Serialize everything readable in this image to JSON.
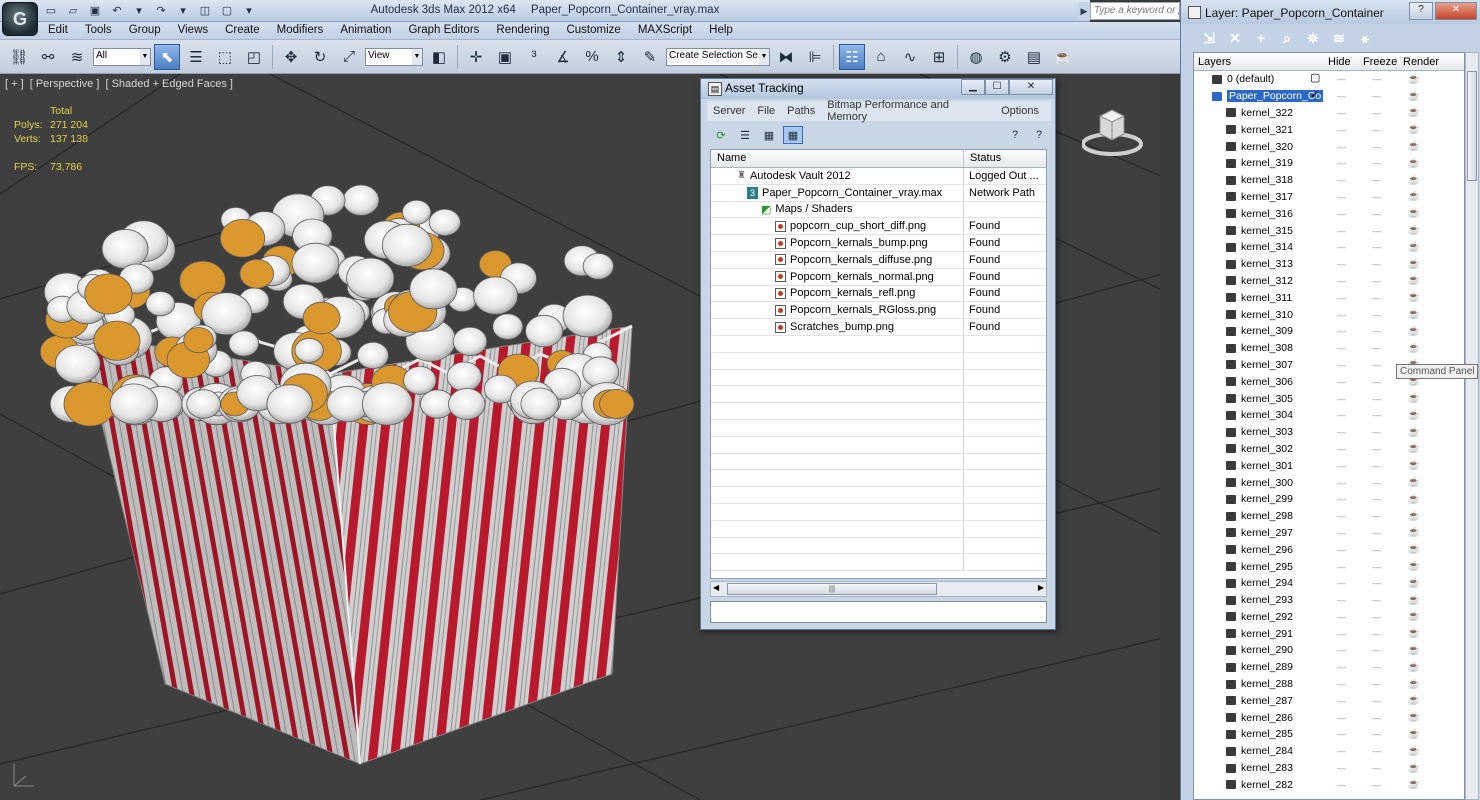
{
  "window": {
    "app_title": "Autodesk 3ds Max  2012 x64",
    "file_title": "Paper_Popcorn_Container_vray.max",
    "search_placeholder": "Type a keyword or phrase"
  },
  "menu": [
    "Edit",
    "Tools",
    "Group",
    "Views",
    "Create",
    "Modifiers",
    "Animation",
    "Graph Editors",
    "Rendering",
    "Customize",
    "MAXScript",
    "Help"
  ],
  "toolbar": {
    "filter_value": "All",
    "ref_coord_value": "View",
    "named_selection_value": "Create Selection Se"
  },
  "viewport": {
    "labels": [
      "[ + ]",
      "[ Perspective ]",
      "[ Shaded + Edged Faces ]"
    ],
    "stats": {
      "total_label": "Total",
      "polys_label": "Polys:",
      "polys_value": "271 204",
      "verts_label": "Verts:",
      "verts_value": "137 138",
      "fps_label": "FPS:",
      "fps_value": "73,786"
    }
  },
  "asset_tracking": {
    "title": "Asset Tracking",
    "menu": [
      "Server",
      "File",
      "Paths",
      "Bitmap Performance and Memory",
      "Options"
    ],
    "columns": [
      "Name",
      "Status"
    ],
    "rows": [
      {
        "name": "Autodesk Vault 2012",
        "status": "Logged Out ...",
        "icon": "vault-icon",
        "indent": 0
      },
      {
        "name": "Paper_Popcorn_Container_vray.max",
        "status": "Network Path",
        "icon": "max-file-icon",
        "indent": 1
      },
      {
        "name": "Maps / Shaders",
        "status": "",
        "icon": "maps-folder-icon",
        "indent": 2
      },
      {
        "name": "popcorn_cup_short_diff.png",
        "status": "Found",
        "icon": "image-file-icon",
        "indent": 3
      },
      {
        "name": "Popcorn_kernals_bump.png",
        "status": "Found",
        "icon": "image-file-icon",
        "indent": 3
      },
      {
        "name": "Popcorn_kernals_diffuse.png",
        "status": "Found",
        "icon": "image-file-icon",
        "indent": 3
      },
      {
        "name": "Popcorn_kernals_normal.png",
        "status": "Found",
        "icon": "image-file-icon",
        "indent": 3
      },
      {
        "name": "Popcorn_kernals_refl.png",
        "status": "Found",
        "icon": "image-file-icon",
        "indent": 3
      },
      {
        "name": "Popcorn_kernals_RGloss.png",
        "status": "Found",
        "icon": "image-file-icon",
        "indent": 3
      },
      {
        "name": "Scratches_bump.png",
        "status": "Found",
        "icon": "image-file-icon",
        "indent": 3
      }
    ]
  },
  "layer_dialog": {
    "title": "Layer: Paper_Popcorn_Container",
    "columns": [
      "Layers",
      "Hide",
      "Freeze",
      "Render"
    ],
    "layers": [
      {
        "name": "0 (default)",
        "level": 0
      },
      {
        "name": "Paper_Popcorn_Co",
        "level": 0,
        "selected": true
      },
      {
        "name": "kernel_322",
        "level": 1
      },
      {
        "name": "kernel_321",
        "level": 1
      },
      {
        "name": "kernel_320",
        "level": 1
      },
      {
        "name": "kernel_319",
        "level": 1
      },
      {
        "name": "kernel_318",
        "level": 1
      },
      {
        "name": "kernel_317",
        "level": 1
      },
      {
        "name": "kernel_316",
        "level": 1
      },
      {
        "name": "kernel_315",
        "level": 1
      },
      {
        "name": "kernel_314",
        "level": 1
      },
      {
        "name": "kernel_313",
        "level": 1
      },
      {
        "name": "kernel_312",
        "level": 1
      },
      {
        "name": "kernel_311",
        "level": 1
      },
      {
        "name": "kernel_310",
        "level": 1
      },
      {
        "name": "kernel_309",
        "level": 1
      },
      {
        "name": "kernel_308",
        "level": 1
      },
      {
        "name": "kernel_307",
        "level": 1
      },
      {
        "name": "kernel_306",
        "level": 1
      },
      {
        "name": "kernel_305",
        "level": 1
      },
      {
        "name": "kernel_304",
        "level": 1
      },
      {
        "name": "kernel_303",
        "level": 1
      },
      {
        "name": "kernel_302",
        "level": 1
      },
      {
        "name": "kernel_301",
        "level": 1
      },
      {
        "name": "kernel_300",
        "level": 1
      },
      {
        "name": "kernel_299",
        "level": 1
      },
      {
        "name": "kernel_298",
        "level": 1
      },
      {
        "name": "kernel_297",
        "level": 1
      },
      {
        "name": "kernel_296",
        "level": 1
      },
      {
        "name": "kernel_295",
        "level": 1
      },
      {
        "name": "kernel_294",
        "level": 1
      },
      {
        "name": "kernel_293",
        "level": 1
      },
      {
        "name": "kernel_292",
        "level": 1
      },
      {
        "name": "kernel_291",
        "level": 1
      },
      {
        "name": "kernel_290",
        "level": 1
      },
      {
        "name": "kernel_289",
        "level": 1
      },
      {
        "name": "kernel_288",
        "level": 1
      },
      {
        "name": "kernel_287",
        "level": 1
      },
      {
        "name": "kernel_286",
        "level": 1
      },
      {
        "name": "kernel_285",
        "level": 1
      },
      {
        "name": "kernel_284",
        "level": 1
      },
      {
        "name": "kernel_283",
        "level": 1
      },
      {
        "name": "kernel_282",
        "level": 1
      }
    ]
  },
  "tooltip": "Command Panel",
  "colors": {
    "stripe_red": "#b8192c",
    "stripe_white": "#d9d9d9",
    "stats_yellow": "#e2d44a",
    "accent_blue": "#2b67c6"
  }
}
